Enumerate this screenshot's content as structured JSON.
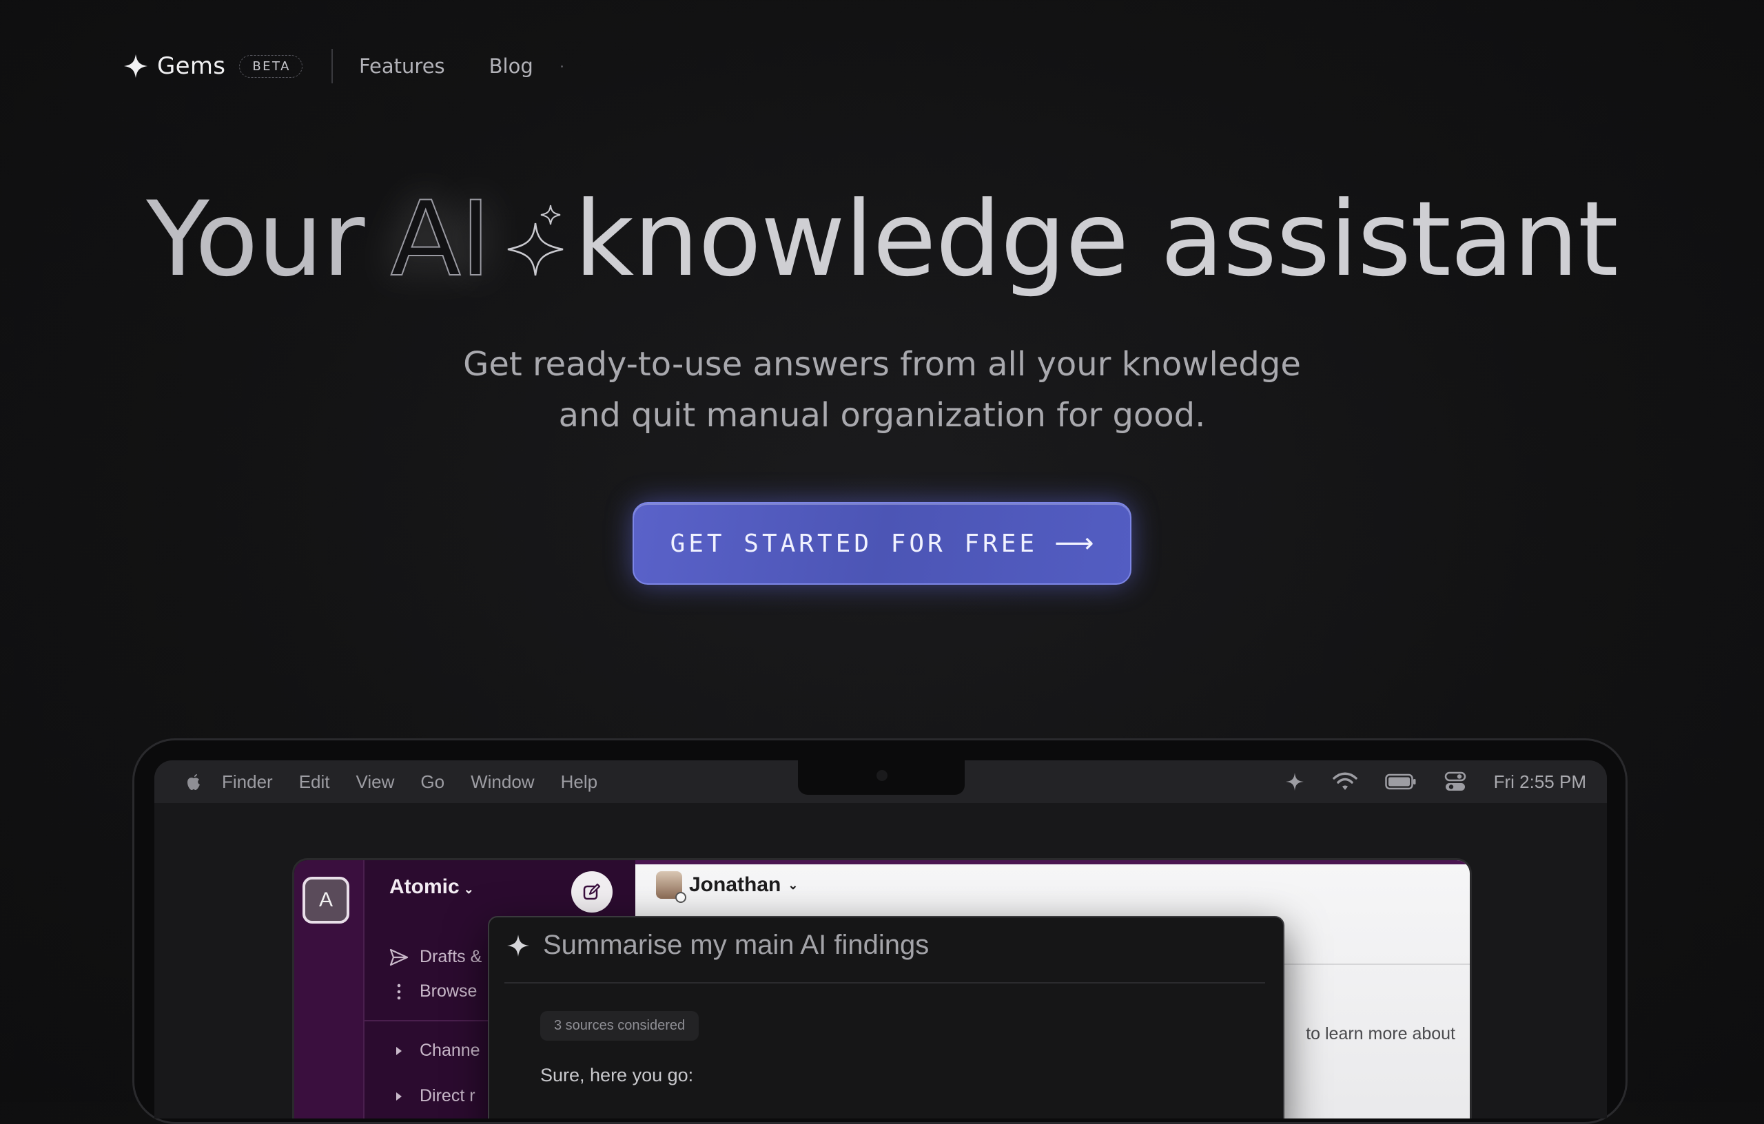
{
  "nav": {
    "brand": "Gems",
    "badge": "BETA",
    "links": [
      "Features",
      "Blog"
    ]
  },
  "hero": {
    "title_parts": [
      "Your",
      "AI",
      "knowledge assistant"
    ],
    "subtitle_line1": "Get ready-to-use answers from all your knowledge",
    "subtitle_line2": "and quit manual organization for good.",
    "cta_label": "GET STARTED FOR FREE",
    "cta_arrow": "⟶"
  },
  "menubar": {
    "items": [
      "Finder",
      "Edit",
      "View",
      "Go",
      "Window",
      "Help"
    ],
    "clock": "Fri 2:55 PM"
  },
  "app": {
    "workspace_initial": "A",
    "workspace_name": "Atomic",
    "sidebar_items": [
      "Drafts &",
      "Browse",
      "Channe",
      "Direct r"
    ],
    "channel_user": "Jonathan",
    "message_fragment": "to learn more about"
  },
  "panel": {
    "query": "Summarise my main AI findings",
    "sources_chip": "3 sources considered",
    "reply_start": "Sure, here you go:"
  },
  "colors": {
    "cta": "#535dc2",
    "slack_sidebar": "#2b0b2f",
    "slack_rail": "#3a0f3e"
  }
}
